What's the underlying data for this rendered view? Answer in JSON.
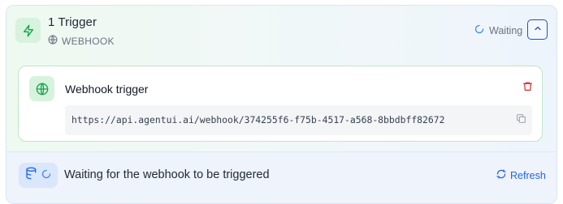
{
  "header": {
    "title": "1 Trigger",
    "type_label": "WEBHOOK",
    "status_label": "Waiting"
  },
  "webhook": {
    "title": "Webhook trigger",
    "url": "https://api.agentui.ai/webhook/374255f6-f75b-4517-a568-8bbdbff82672"
  },
  "footer": {
    "message": "Waiting for the webhook to be triggered",
    "refresh_label": "Refresh"
  },
  "colors": {
    "accent_green": "#16a34a",
    "accent_blue": "#2563eb",
    "danger_red": "#dc2626"
  },
  "icons": {
    "trigger": "zap-icon",
    "type": "globe-icon",
    "status": "spinner-icon",
    "collapse": "chevron-up-icon",
    "webhook": "globe-icon",
    "delete": "trash-icon",
    "copy": "copy-icon",
    "waiting": "database-icon",
    "refresh": "refresh-icon"
  }
}
